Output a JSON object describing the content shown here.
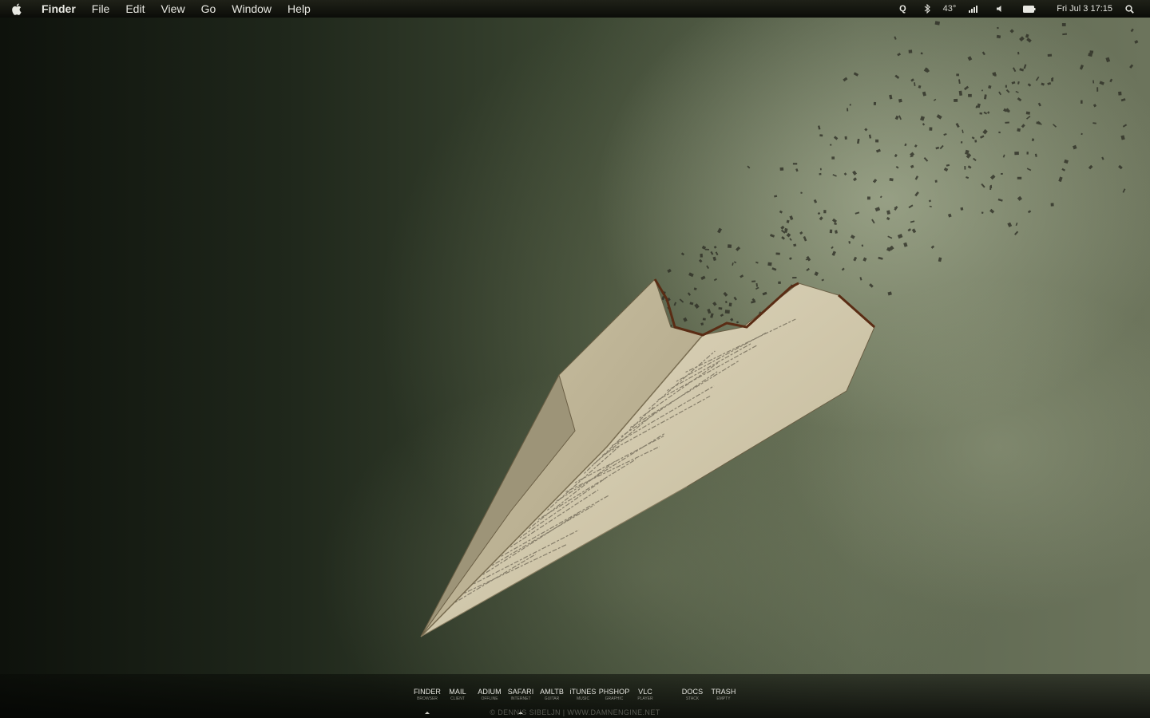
{
  "menubar": {
    "app_name": "Finder",
    "menus": [
      "File",
      "Edit",
      "View",
      "Go",
      "Window",
      "Help"
    ],
    "status": {
      "quicksilver": "Q",
      "temperature": "43°",
      "clock": "Fri Jul 3  17:15"
    }
  },
  "dock": {
    "items": [
      {
        "label": "FINDER",
        "sub": "BROWSER"
      },
      {
        "label": "MAIL",
        "sub": "CLIENT"
      },
      {
        "label": "ADIUM",
        "sub": "OFFLINE"
      },
      {
        "label": "SAFARI",
        "sub": "INTERNET"
      },
      {
        "label": "AMLTB",
        "sub": "GUITAR"
      },
      {
        "label": "iTUNES",
        "sub": "MUSIC"
      },
      {
        "label": "PHSHOP",
        "sub": "GRAPHIC"
      },
      {
        "label": "VLC",
        "sub": "PLAYER"
      },
      {
        "label": "DOCS",
        "sub": "STACK"
      },
      {
        "label": "TRASH",
        "sub": "EMPTY"
      }
    ]
  },
  "wallpaper": {
    "credit": "© DENNIS SIBELJN | WWW.DAMNENGINE.NET"
  },
  "colors": {
    "menubar": "#0b0c08",
    "sky_dark": "#0e120c",
    "sky_light": "#6c745c",
    "paper": "#d8cfb4"
  }
}
